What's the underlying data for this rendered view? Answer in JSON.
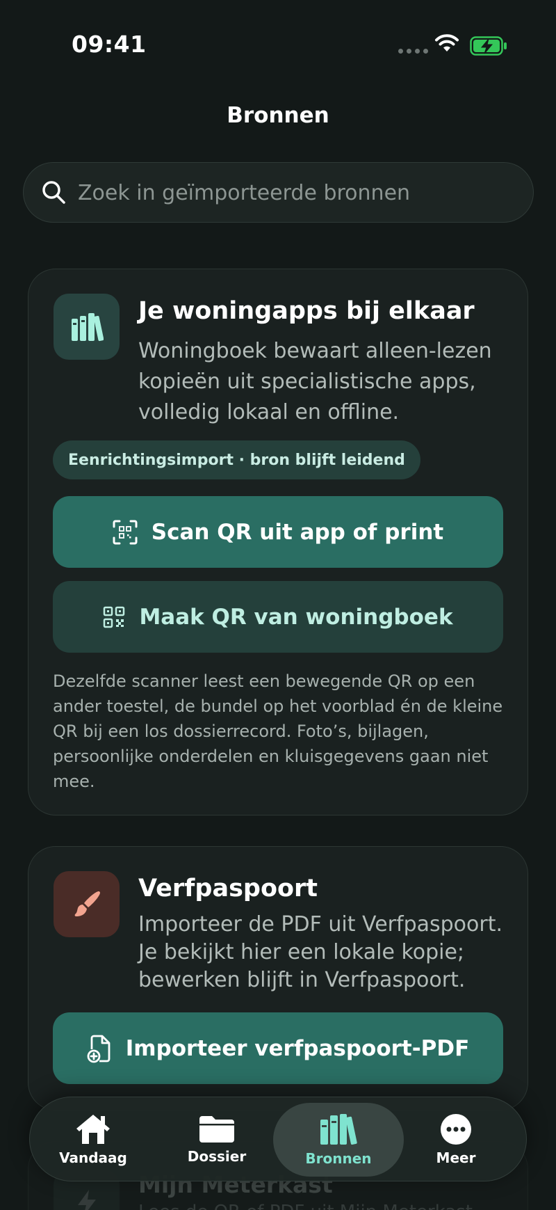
{
  "status": {
    "time": "09:41"
  },
  "nav": {
    "title": "Bronnen"
  },
  "search": {
    "placeholder": "Zoek in geïmporteerde bronnen"
  },
  "card_woningapps": {
    "title": "Je woningapps bij elkaar",
    "description": "Woningboek bewaart alleen-lezen kopieën uit specialistische apps, volledig lokaal en offline.",
    "chip": "Eenrichtingsimport · bron blijft leidend",
    "scan_button": "Scan QR uit app of print",
    "make_button": "Maak QR van woningboek",
    "note": "Dezelfde scanner leest een bewegende QR op een ander toestel, de bundel op het voorblad én de kleine QR bij een los dossierrecord. Foto’s, bijlagen, persoonlijke onderdelen en kluisgegevens gaan niet mee."
  },
  "card_verfpaspoort": {
    "title": "Verfpaspoort",
    "description": "Importeer de PDF uit Verfpaspoort. Je bekijkt hier een lokale kopie; bewerken blijft in Verfpaspoort.",
    "import_button": "Importeer verfpaspoort-PDF"
  },
  "card_meterkast": {
    "title": "Mijn Meterkast",
    "description": "Lees de QR of PDF uit Mijn Meterkast"
  },
  "tabs": [
    {
      "label": "Vandaag",
      "icon": "house-icon"
    },
    {
      "label": "Dossier",
      "icon": "folder-icon"
    },
    {
      "label": "Bronnen",
      "icon": "books-icon",
      "active": true
    },
    {
      "label": "Meer",
      "icon": "more-icon"
    }
  ],
  "colors": {
    "accent": "#2a6e63",
    "accent_light": "#7fe3cf",
    "background": "#131918",
    "battery": "#34c759"
  }
}
